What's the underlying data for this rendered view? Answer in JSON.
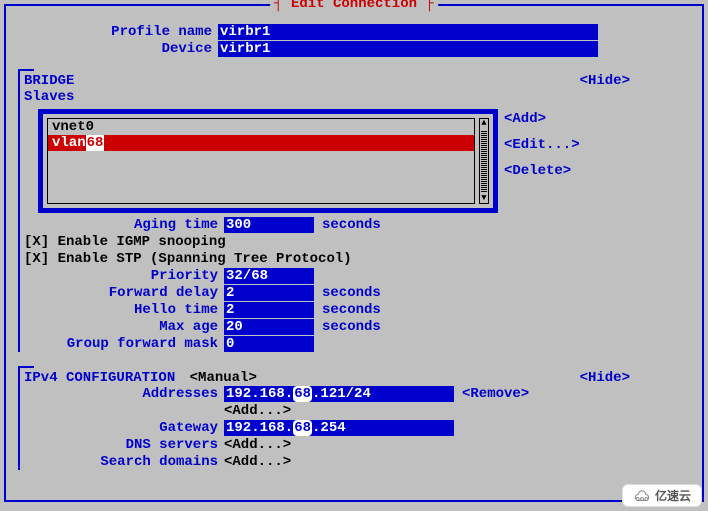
{
  "title": "Edit Connection",
  "profile": {
    "name_label": "Profile name",
    "name_value": "virbr1",
    "device_label": "Device",
    "device_value": "virbr1"
  },
  "bridge": {
    "header": "BRIDGE",
    "slaves_label": "Slaves",
    "hide": "<Hide>",
    "items": [
      "vnet0",
      "vlan"
    ],
    "selected_suffix": "68",
    "actions": {
      "add": "<Add>",
      "edit": "<Edit...>",
      "delete": "<Delete>"
    },
    "aging_label": "Aging time",
    "aging_value": "300",
    "aging_unit": "seconds",
    "igmp": "[X] Enable IGMP snooping",
    "stp": "[X] Enable STP (Spanning Tree Protocol)",
    "priority_label": "Priority",
    "priority_value": "32/68",
    "fwd_delay_label": "Forward delay",
    "fwd_delay_value": "2",
    "hello_label": "Hello time",
    "hello_value": "2",
    "maxage_label": "Max age",
    "maxage_value": "20",
    "group_mask_label": "Group forward mask",
    "group_mask_value": "0",
    "seconds": "seconds"
  },
  "ipv4": {
    "header": "IPv4 CONFIGURATION",
    "mode": "<Manual>",
    "hide": "<Hide>",
    "addresses_label": "Addresses",
    "address_val_pre": "192.168.",
    "address_val_mid": "68",
    "address_val_post": ".121/24",
    "remove": "<Remove>",
    "add": "<Add...>",
    "gateway_label": "Gateway",
    "gateway_pre": "192.168.",
    "gateway_mid": "68",
    "gateway_post": ".254",
    "dns_label": "DNS servers",
    "search_label": "Search domains"
  },
  "watermark": "亿速云"
}
